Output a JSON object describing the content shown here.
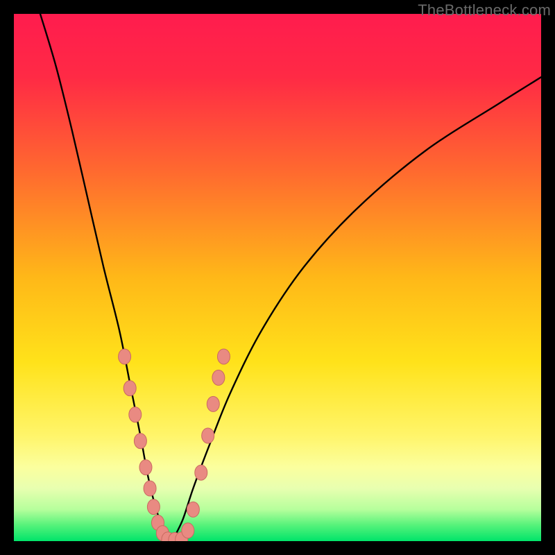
{
  "watermark": "TheBottleneck.com",
  "colors": {
    "frame": "#000000",
    "gradient_stops": [
      {
        "offset": 0.0,
        "color": "#ff1c4e"
      },
      {
        "offset": 0.12,
        "color": "#ff2a45"
      },
      {
        "offset": 0.3,
        "color": "#ff6a2f"
      },
      {
        "offset": 0.5,
        "color": "#ffb818"
      },
      {
        "offset": 0.66,
        "color": "#ffe21a"
      },
      {
        "offset": 0.8,
        "color": "#fff56a"
      },
      {
        "offset": 0.86,
        "color": "#fbff9e"
      },
      {
        "offset": 0.9,
        "color": "#e8ffb0"
      },
      {
        "offset": 0.94,
        "color": "#b6ff9c"
      },
      {
        "offset": 0.97,
        "color": "#55f27a"
      },
      {
        "offset": 1.0,
        "color": "#00e46a"
      }
    ],
    "curve": "#000000",
    "marker_fill": "#e98a82",
    "marker_stroke": "#c96a60"
  },
  "chart_data": {
    "type": "line",
    "title": "",
    "xlabel": "",
    "ylabel": "",
    "xlim": [
      0,
      100
    ],
    "ylim": [
      0,
      100
    ],
    "grid": false,
    "legend": false,
    "series": [
      {
        "name": "bottleneck-curve-left",
        "x": [
          5,
          8,
          11,
          14,
          17,
          20,
          22,
          24,
          25.5,
          27,
          28.5,
          30
        ],
        "y": [
          100,
          90,
          78,
          65,
          52,
          40,
          30,
          20,
          12,
          6,
          2,
          0
        ]
      },
      {
        "name": "bottleneck-curve-right",
        "x": [
          30,
          32,
          34,
          37,
          41,
          47,
          55,
          65,
          78,
          92,
          100
        ],
        "y": [
          0,
          4,
          10,
          18,
          28,
          40,
          52,
          63,
          74,
          83,
          88
        ]
      }
    ],
    "markers": {
      "name": "highlight-points",
      "points": [
        {
          "x": 21.0,
          "y": 35
        },
        {
          "x": 22.0,
          "y": 29
        },
        {
          "x": 23.0,
          "y": 24
        },
        {
          "x": 24.0,
          "y": 19
        },
        {
          "x": 25.0,
          "y": 14
        },
        {
          "x": 25.8,
          "y": 10
        },
        {
          "x": 26.5,
          "y": 6.5
        },
        {
          "x": 27.3,
          "y": 3.5
        },
        {
          "x": 28.2,
          "y": 1.5
        },
        {
          "x": 29.2,
          "y": 0.3
        },
        {
          "x": 30.5,
          "y": 0.2
        },
        {
          "x": 31.8,
          "y": 0.3
        },
        {
          "x": 33.0,
          "y": 2.0
        },
        {
          "x": 34.0,
          "y": 6.0
        },
        {
          "x": 35.5,
          "y": 13
        },
        {
          "x": 36.8,
          "y": 20
        },
        {
          "x": 37.8,
          "y": 26
        },
        {
          "x": 38.8,
          "y": 31
        },
        {
          "x": 39.8,
          "y": 35
        }
      ]
    }
  }
}
